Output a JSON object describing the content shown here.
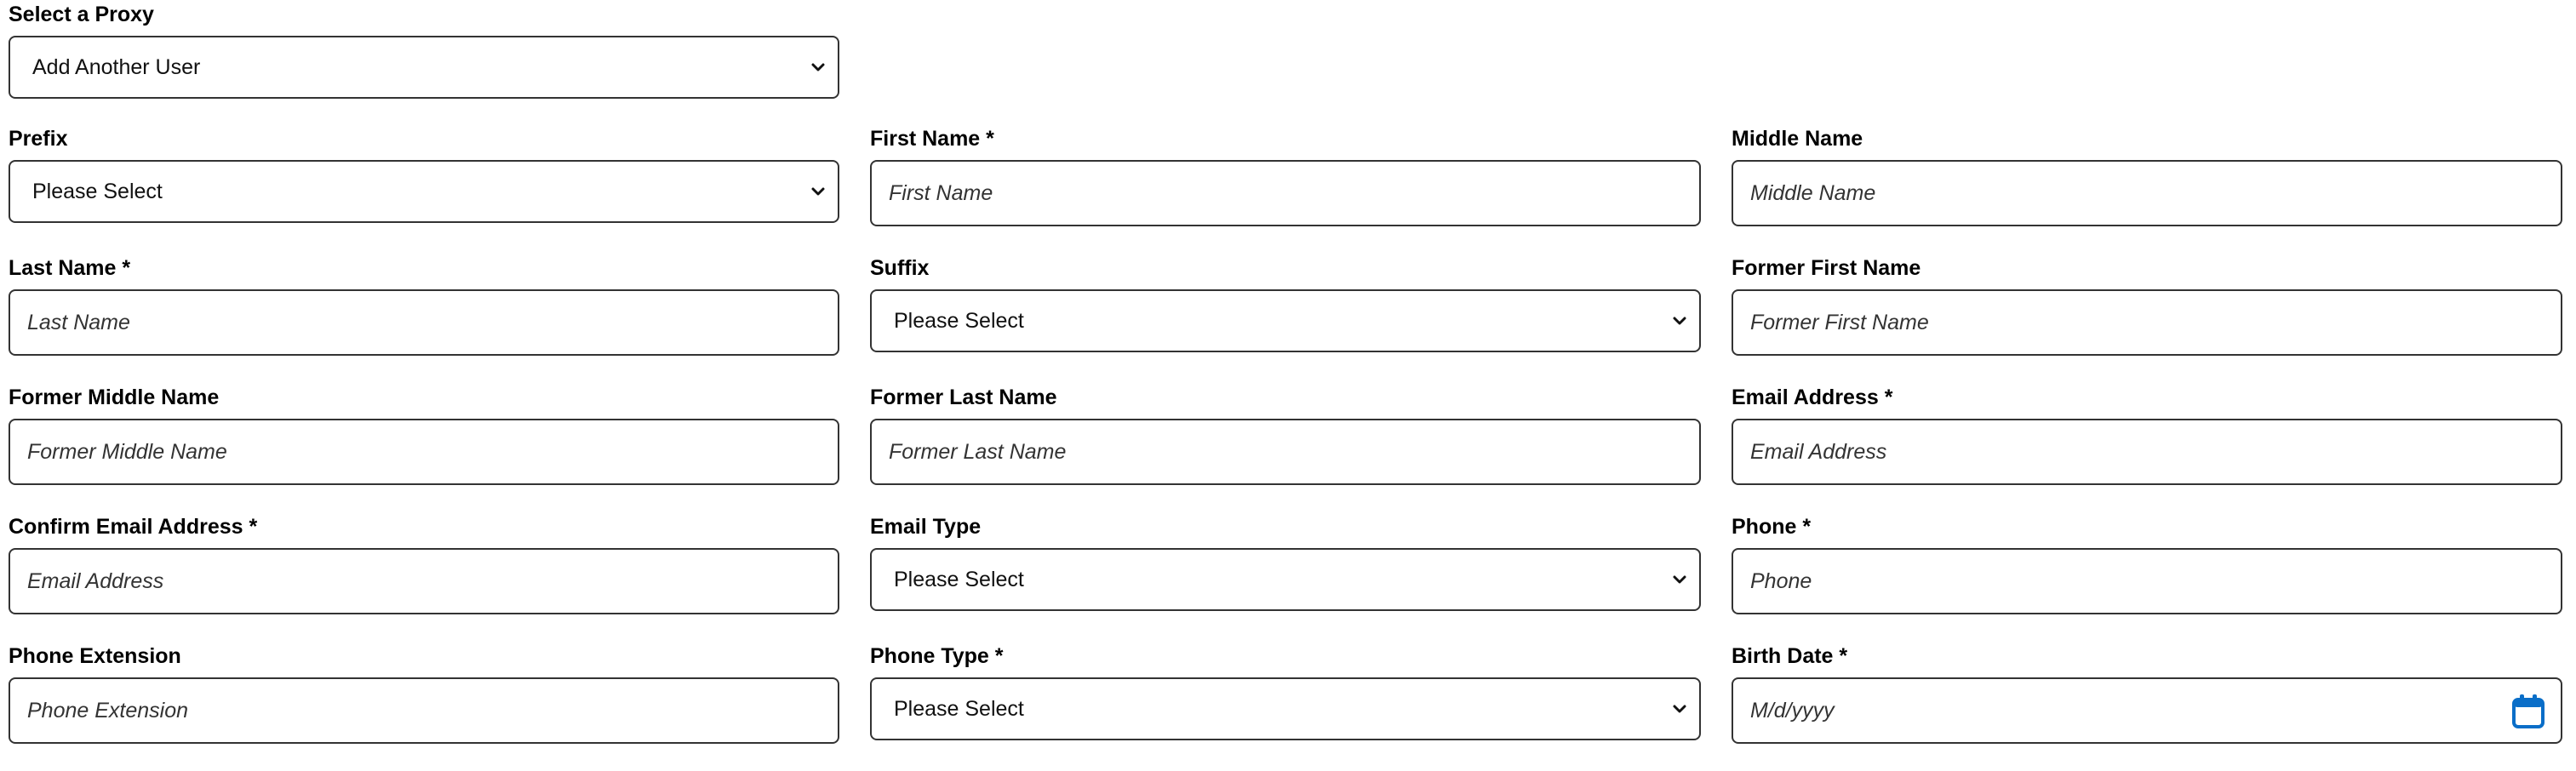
{
  "proxy": {
    "label": "Select a Proxy",
    "value": "Add Another User"
  },
  "fields": {
    "prefix": {
      "label": "Prefix",
      "value": "Please Select"
    },
    "first_name": {
      "label": "First Name *",
      "placeholder": "First Name"
    },
    "middle_name": {
      "label": "Middle Name",
      "placeholder": "Middle Name"
    },
    "last_name": {
      "label": "Last Name *",
      "placeholder": "Last Name"
    },
    "suffix": {
      "label": "Suffix",
      "value": "Please Select"
    },
    "former_first_name": {
      "label": "Former First Name",
      "placeholder": "Former First Name"
    },
    "former_middle_name": {
      "label": "Former Middle Name",
      "placeholder": "Former Middle Name"
    },
    "former_last_name": {
      "label": "Former Last Name",
      "placeholder": "Former Last Name"
    },
    "email_address": {
      "label": "Email Address *",
      "placeholder": "Email Address"
    },
    "confirm_email": {
      "label": "Confirm Email Address *",
      "placeholder": "Email Address"
    },
    "email_type": {
      "label": "Email Type",
      "value": "Please Select"
    },
    "phone": {
      "label": "Phone *",
      "placeholder": "Phone"
    },
    "phone_extension": {
      "label": "Phone Extension",
      "placeholder": "Phone Extension"
    },
    "phone_type": {
      "label": "Phone Type *",
      "value": "Please Select"
    },
    "birth_date": {
      "label": "Birth Date *",
      "placeholder": "M/d/yyyy",
      "icon": "calendar-icon"
    }
  },
  "colors": {
    "border": "#333333",
    "calendar_accent": "#0a6ec8"
  }
}
